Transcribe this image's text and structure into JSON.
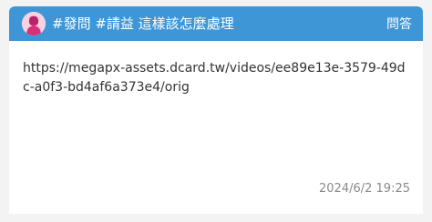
{
  "header": {
    "title": "#發問 #請益 這樣該怎麼處理",
    "tag": "問答",
    "avatar_icon": "female-avatar-icon"
  },
  "post": {
    "body": "https://megapx-assets.dcard.tw/videos/ee89e13e-3579-49dc-a0f3-bd4af6a373e4/orig",
    "timestamp": "2024/6/2 19:25"
  },
  "colors": {
    "header_bg": "#3f96d6",
    "avatar_bg": "#ffffff",
    "avatar_figure": "#d8307a"
  }
}
